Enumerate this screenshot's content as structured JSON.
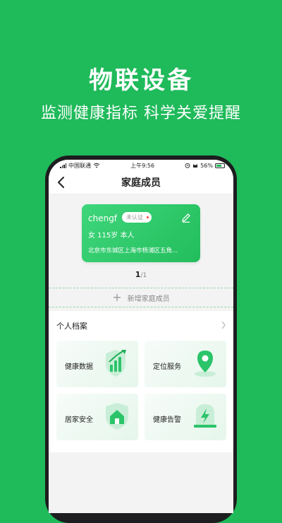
{
  "hero": {
    "title": "物联设备",
    "subtitle": "监测健康指标 科学关爱提醒"
  },
  "statusbar": {
    "carrier": "中国联通",
    "time": "上午9:56",
    "battery": "56%"
  },
  "header": {
    "title": "家庭成员"
  },
  "member_card": {
    "name": "chengf",
    "badge": "未认证",
    "info": "女  115岁  本人",
    "address": "北京市东城区上海市杨浦区五角..."
  },
  "pager": {
    "current": "1",
    "total": "/1"
  },
  "add_member": {
    "label": "新增家庭成员"
  },
  "profile": {
    "section_title": "个人档案",
    "tiles": [
      {
        "label": "健康数据",
        "icon": "chart-shield-icon"
      },
      {
        "label": "定位服务",
        "icon": "location-pin-icon"
      },
      {
        "label": "居家安全",
        "icon": "home-shield-icon"
      },
      {
        "label": "健康告警",
        "icon": "alarm-lightning-icon"
      }
    ]
  },
  "colors": {
    "brand_green": "#1fba5a",
    "dashed_line": "#8fd9a8",
    "badge_dot": "#f04040"
  }
}
